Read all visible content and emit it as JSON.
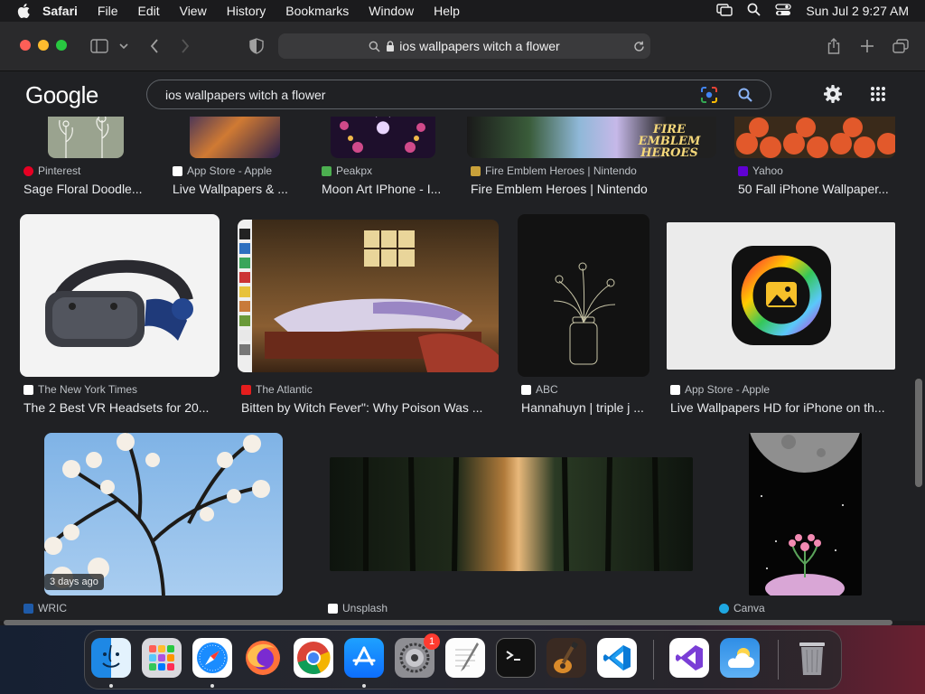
{
  "menubar": {
    "app": "Safari",
    "items": [
      "File",
      "Edit",
      "View",
      "History",
      "Bookmarks",
      "Window",
      "Help"
    ],
    "clock": "Sun Jul 2  9:27 AM"
  },
  "browser": {
    "url": "ios wallpapers witch a flower"
  },
  "google": {
    "logo": "Google",
    "query": "ios wallpapers witch a flower"
  },
  "results": {
    "row1": [
      {
        "source": "Pinterest",
        "title": "Sage Floral Doodle...",
        "fav_color": "#e60023"
      },
      {
        "source": "App Store - Apple",
        "title": "Live Wallpapers & ...",
        "fav_color": "#ffffff"
      },
      {
        "source": "Peakpx",
        "title": "Moon Art IPhone - I...",
        "fav_color": "#4caf50"
      },
      {
        "source": "Fire Emblem Heroes | Nintendo",
        "title": "Fire Emblem Heroes | Nintendo",
        "fav_color": "#c9a13a"
      },
      {
        "source": "Yahoo",
        "title": "50 Fall iPhone Wallpaper...",
        "fav_color": "#6001d2"
      }
    ],
    "row2": [
      {
        "source": "The New York Times",
        "title": "The 2 Best VR Headsets for 20...",
        "fav_color": "#ffffff"
      },
      {
        "source": "The Atlantic",
        "title": "Bitten by Witch Fever\": Why Poison Was ...",
        "fav_color": "#e51d1d"
      },
      {
        "source": "ABC",
        "title": "Hannahuyn | triple j ...",
        "fav_color": "#ffffff"
      },
      {
        "source": "App Store - Apple",
        "title": "Live Wallpapers HD for iPhone on th...",
        "fav_color": "#ffffff"
      }
    ],
    "row3": [
      {
        "source": "WRIC",
        "badge": "3 days ago",
        "fav_color": "#1e5aa8"
      },
      {
        "source": "Unsplash",
        "fav_color": "#ffffff"
      },
      {
        "source": "Canva",
        "fav_color": "#1ea7e1"
      }
    ]
  },
  "fire_emblem_logo": "FIRE EMBLEM HEROES",
  "dock": {
    "apps": [
      "finder-icon",
      "launchpad-icon",
      "safari-icon",
      "firefox-icon",
      "chrome-icon",
      "app-store-icon",
      "system-settings-icon",
      "textedit-icon",
      "terminal-icon",
      "garageband-icon",
      "vscode-icon",
      "visual-studio-icon",
      "weather-icon",
      "trash-icon"
    ],
    "settings_badge": "1"
  },
  "colors": {
    "accent": "#8ab4f8",
    "page_bg": "#202124",
    "toolbar_bg": "#2a2a2c"
  }
}
